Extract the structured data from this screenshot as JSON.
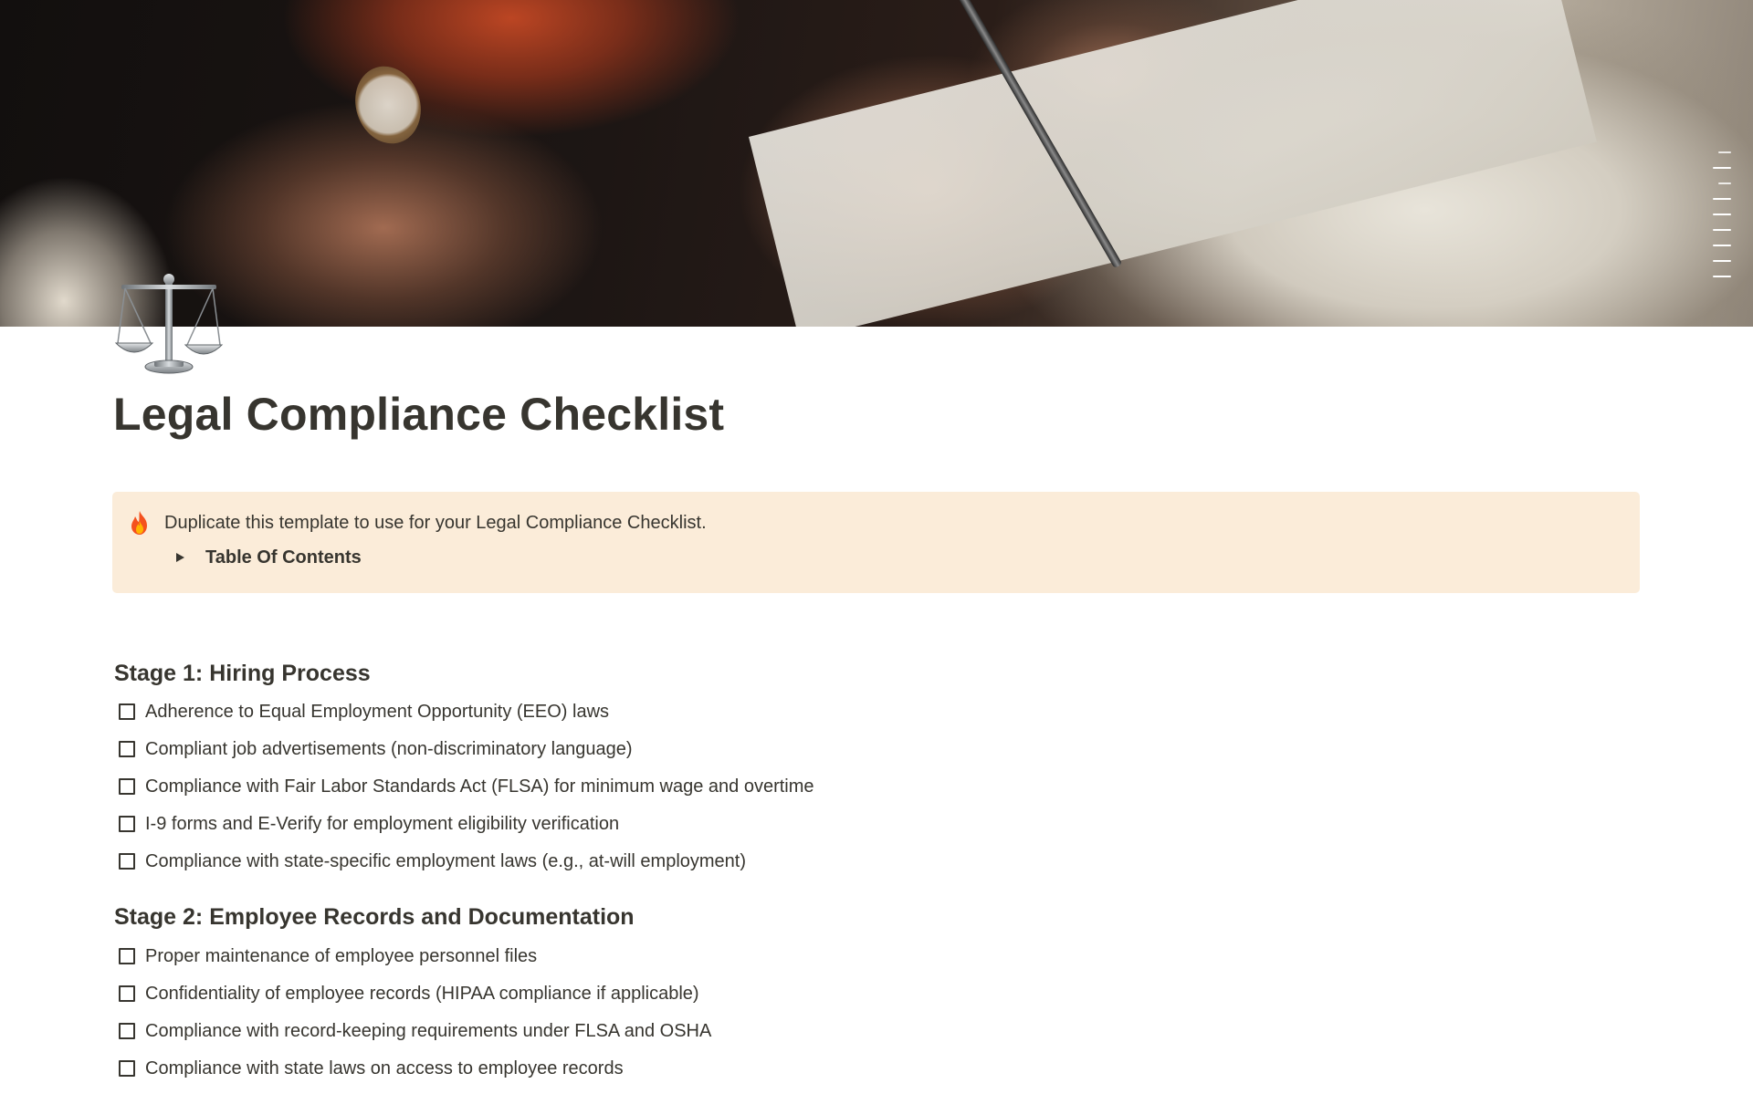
{
  "cover": {
    "image": "hands signing a document with a pen"
  },
  "page": {
    "icon": "balance-scale-icon",
    "title": "Legal Compliance Checklist"
  },
  "callout": {
    "icon": "fire-icon",
    "text": "Duplicate this template to use for your Legal Compliance Checklist.",
    "toggle_label": "Table Of Contents",
    "background": "#fbecd9"
  },
  "sections": [
    {
      "heading": "Stage 1: Hiring Process",
      "items": [
        {
          "label": "Adherence to Equal Employment Opportunity (EEO) laws",
          "checked": false
        },
        {
          "label": "Compliant job advertisements (non-discriminatory language)",
          "checked": false
        },
        {
          "label": "Compliance with Fair Labor Standards Act (FLSA) for minimum wage and overtime",
          "checked": false
        },
        {
          "label": "I-9 forms and E-Verify for employment eligibility verification",
          "checked": false
        },
        {
          "label": "Compliance with state-specific employment laws (e.g., at-will employment)",
          "checked": false
        }
      ]
    },
    {
      "heading": "Stage 2: Employee Records and Documentation",
      "items": [
        {
          "label": "Proper maintenance of employee personnel files",
          "checked": false
        },
        {
          "label": "Confidentiality of employee records (HIPAA compliance if applicable)",
          "checked": false
        },
        {
          "label": "Compliance with record-keeping requirements under FLSA and OSHA",
          "checked": false
        },
        {
          "label": "Compliance with state laws on access to employee records",
          "checked": false
        }
      ]
    }
  ],
  "outline_lines": 10
}
